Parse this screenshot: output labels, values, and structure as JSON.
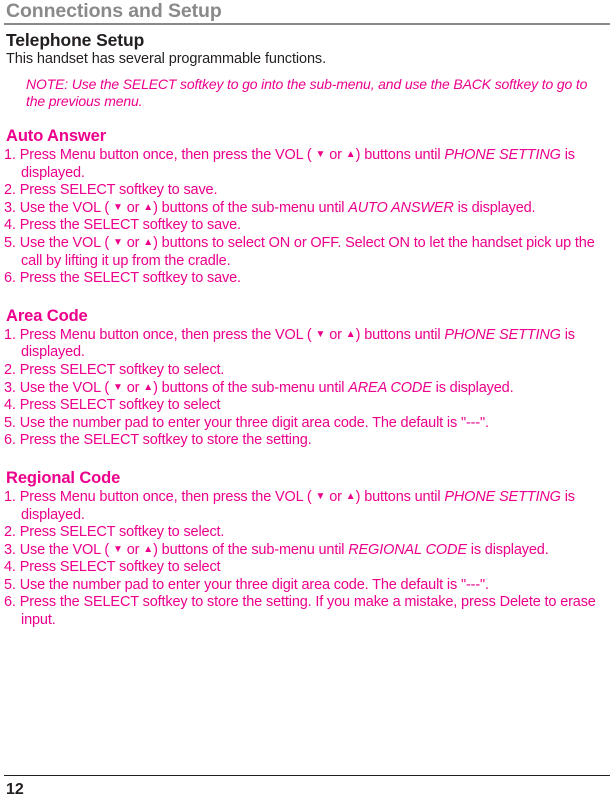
{
  "running_head": "Connections and Setup",
  "title": "Telephone Setup",
  "intro": "This handset has several programmable functions.",
  "note": "NOTE: Use the SELECT softkey to go into the sub-menu, and use the BACK softkey to go to the previous menu.",
  "colors": {
    "accent_pink": "#ec008c",
    "running_head_gray": "#8a8a8a",
    "body_dark": "#231f20"
  },
  "icons": {
    "volume_down": "▼",
    "volume_up": "▲"
  },
  "sections": [
    {
      "title": "Auto Answer",
      "steps": [
        {
          "number": "1.",
          "parts": [
            {
              "t": "Press Menu button once, then press the VOL ( "
            },
            {
              "t": "▼",
              "style": "arrow"
            },
            {
              "t": " or "
            },
            {
              "t": "▲",
              "style": "arrow"
            },
            {
              "t": ") buttons until "
            },
            {
              "t": "PHONE SETTING",
              "style": "italic"
            },
            {
              "t": " is displayed."
            }
          ]
        },
        {
          "number": "2.",
          "parts": [
            {
              "t": "Press SELECT softkey to save."
            }
          ]
        },
        {
          "number": "3.",
          "parts": [
            {
              "t": "Use the VOL ( "
            },
            {
              "t": "▼",
              "style": "arrow"
            },
            {
              "t": " or "
            },
            {
              "t": "▲",
              "style": "arrow"
            },
            {
              "t": ") buttons of the sub-menu until "
            },
            {
              "t": "AUTO ANSWER",
              "style": "italic"
            },
            {
              "t": " is displayed."
            }
          ]
        },
        {
          "number": "4.",
          "parts": [
            {
              "t": "Press the SELECT softkey to save."
            }
          ]
        },
        {
          "number": "5.",
          "parts": [
            {
              "t": "Use the VOL ( "
            },
            {
              "t": "▼",
              "style": "arrow"
            },
            {
              "t": " or "
            },
            {
              "t": "▲",
              "style": "arrow"
            },
            {
              "t": ") buttons to select ON or OFF. Select ON to let the handset pick up the call by lifting it up from the cradle."
            }
          ]
        },
        {
          "number": "6.",
          "parts": [
            {
              "t": "Press the SELECT softkey to save."
            }
          ]
        }
      ]
    },
    {
      "title": "Area Code",
      "steps": [
        {
          "number": "1.",
          "parts": [
            {
              "t": "Press Menu button once, then press the VOL ( "
            },
            {
              "t": "▼",
              "style": "arrow"
            },
            {
              "t": " or "
            },
            {
              "t": "▲",
              "style": "arrow"
            },
            {
              "t": ") buttons until "
            },
            {
              "t": "PHONE SETTING",
              "style": "italic"
            },
            {
              "t": " is displayed."
            }
          ]
        },
        {
          "number": "2.",
          "parts": [
            {
              "t": "Press SELECT softkey to select."
            }
          ]
        },
        {
          "number": "3.",
          "parts": [
            {
              "t": "Use the VOL ( "
            },
            {
              "t": "▼",
              "style": "arrow"
            },
            {
              "t": " or "
            },
            {
              "t": "▲",
              "style": "arrow"
            },
            {
              "t": ") buttons of the sub-menu until "
            },
            {
              "t": "AREA CODE",
              "style": "italic"
            },
            {
              "t": " is displayed."
            }
          ]
        },
        {
          "number": "4.",
          "parts": [
            {
              "t": "Press SELECT softkey to select"
            }
          ]
        },
        {
          "number": "5.",
          "parts": [
            {
              "t": "Use the number pad to enter your three digit area code. The default is \"---\"."
            }
          ]
        },
        {
          "number": "6.",
          "parts": [
            {
              "t": "Press the SELECT softkey to store the setting."
            }
          ]
        }
      ]
    },
    {
      "title": "Regional Code",
      "steps": [
        {
          "number": "1.",
          "parts": [
            {
              "t": "Press Menu button once, then press the VOL ( "
            },
            {
              "t": "▼",
              "style": "arrow"
            },
            {
              "t": " or "
            },
            {
              "t": "▲",
              "style": "arrow"
            },
            {
              "t": ") buttons until "
            },
            {
              "t": "PHONE SETTING",
              "style": "italic"
            },
            {
              "t": " is displayed."
            }
          ]
        },
        {
          "number": "2.",
          "parts": [
            {
              "t": "Press SELECT softkey to select."
            }
          ]
        },
        {
          "number": "3.",
          "parts": [
            {
              "t": "Use the VOL ( "
            },
            {
              "t": "▼",
              "style": "arrow"
            },
            {
              "t": " or "
            },
            {
              "t": "▲",
              "style": "arrow"
            },
            {
              "t": ") buttons of the sub-menu until "
            },
            {
              "t": "REGIONAL CODE",
              "style": "italic"
            },
            {
              "t": " is displayed."
            }
          ]
        },
        {
          "number": "4.",
          "parts": [
            {
              "t": "Press SELECT softkey to select"
            }
          ]
        },
        {
          "number": "5.",
          "parts": [
            {
              "t": "Use the number pad to enter your three digit area code. The default is \"---\"."
            }
          ]
        },
        {
          "number": "6.",
          "parts": [
            {
              "t": "Press the SELECT softkey to store the setting. If you make a mistake, press Delete to erase input."
            }
          ]
        }
      ]
    }
  ],
  "page_number": "12"
}
